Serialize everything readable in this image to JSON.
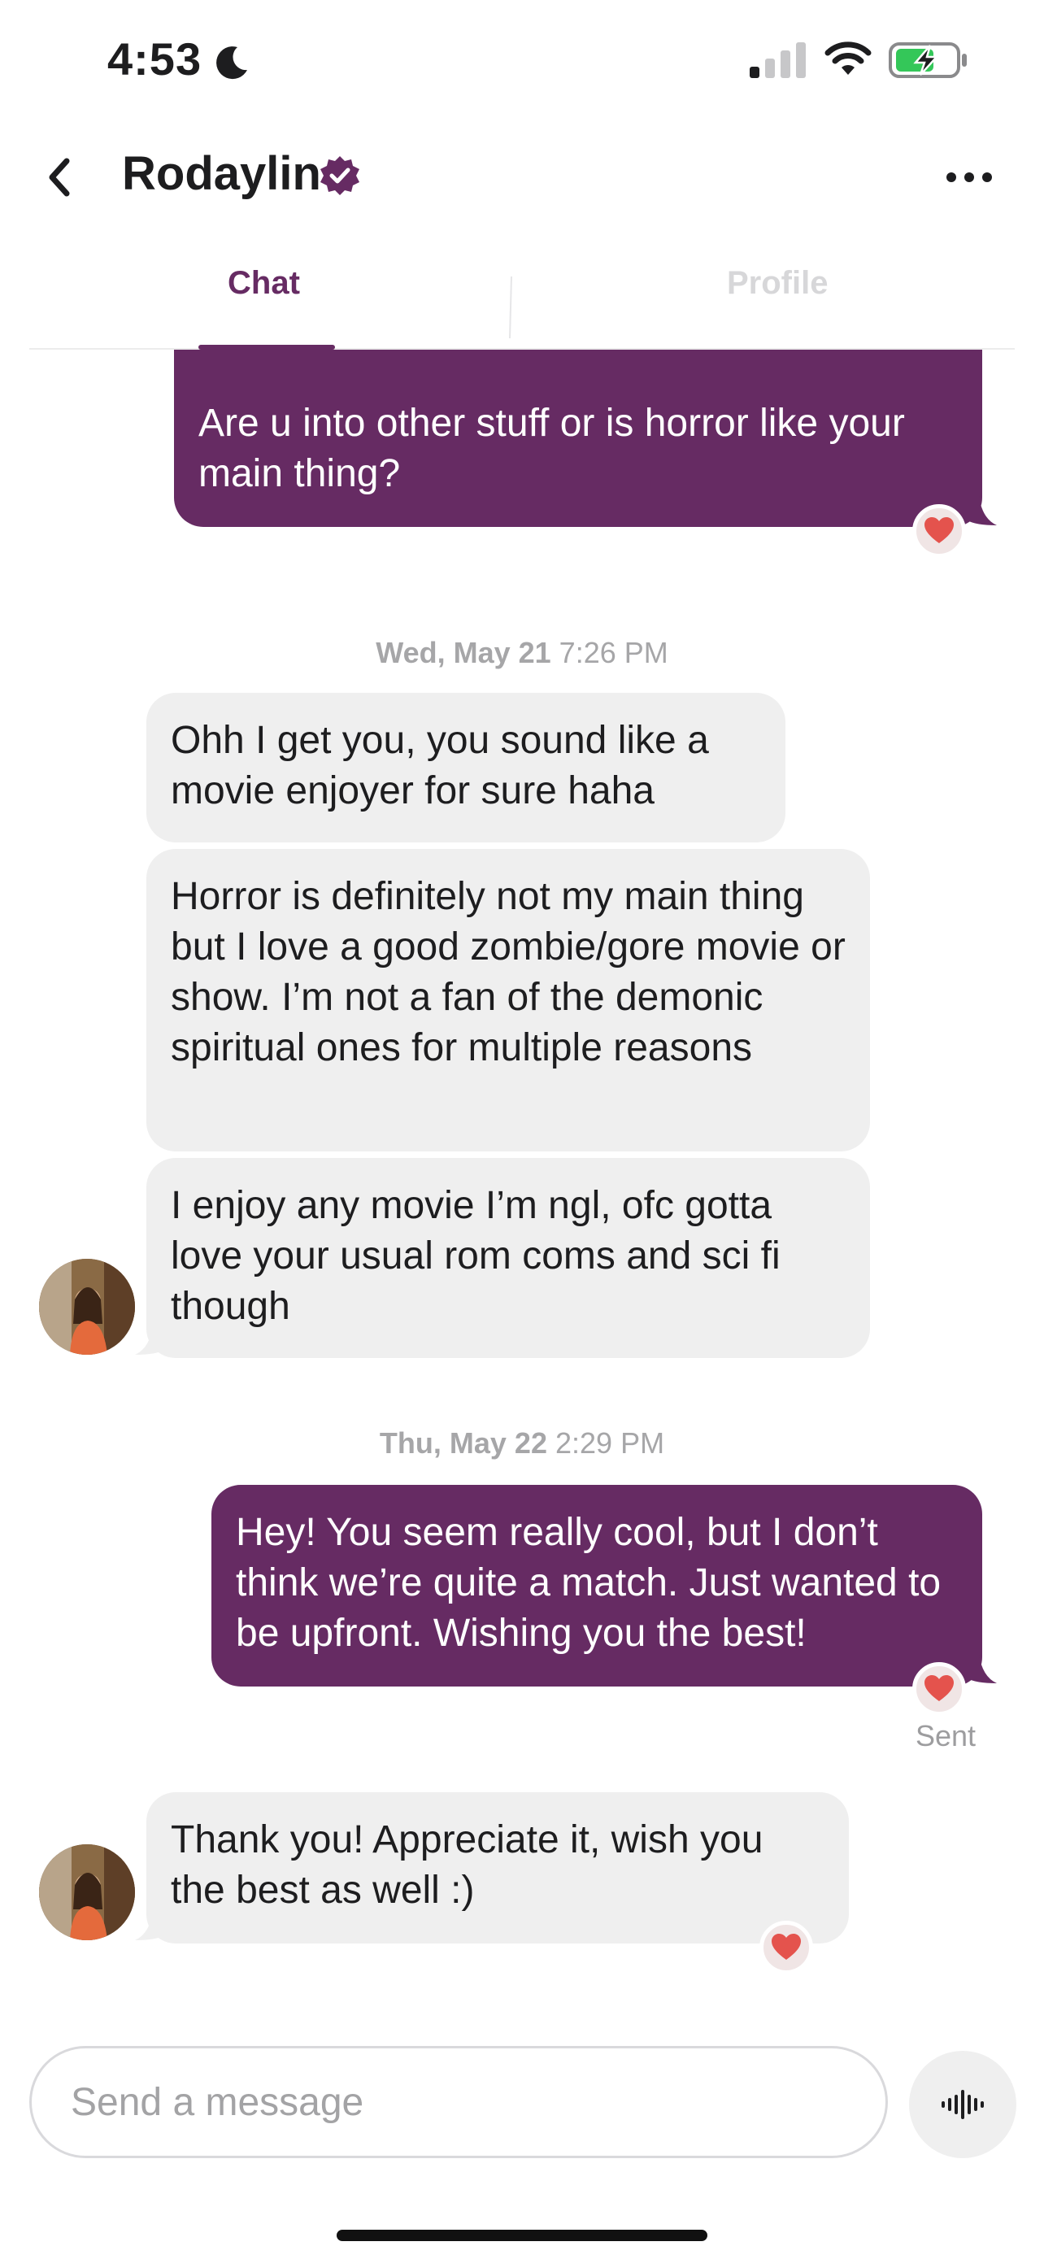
{
  "status_bar": {
    "time": "4:53"
  },
  "header": {
    "title": "Rodaylin"
  },
  "tabs": [
    {
      "label": "Chat",
      "active": true
    },
    {
      "label": "Profile",
      "active": false
    }
  ],
  "messages": [
    {
      "direction": "out",
      "text": "Are u into other stuff or is horror like your main thing?",
      "reaction": "heart"
    },
    {
      "type": "date",
      "day": "Wed, May 21",
      "time": "7:26 PM"
    },
    {
      "direction": "in",
      "text": "Ohh I get you, you sound like a movie enjoyer for sure haha"
    },
    {
      "direction": "in",
      "text": "Horror is definitely not my main thing but I love a good zombie/gore movie or show. I’m not a fan of the demonic spiritual ones for multiple reasons"
    },
    {
      "direction": "in",
      "text": "I enjoy any movie I’m ngl, ofc gotta love your usual rom coms and sci fi though"
    },
    {
      "type": "date",
      "day": "Thu, May 22",
      "time": "2:29 PM"
    },
    {
      "direction": "out",
      "text": "Hey! You seem really cool, but I don’t think we’re quite a match. Just wanted to be upfront. Wishing you the best!",
      "reaction": "heart",
      "status": "Sent"
    },
    {
      "direction": "in",
      "text": "Thank you! Appreciate it, wish you the best as well :)",
      "reaction": "heart"
    }
  ],
  "composer": {
    "placeholder": "Send a message"
  },
  "colors": {
    "accent": "#662b63",
    "incoming_bubble": "#efefef",
    "reaction_heart": "#e4534d"
  }
}
